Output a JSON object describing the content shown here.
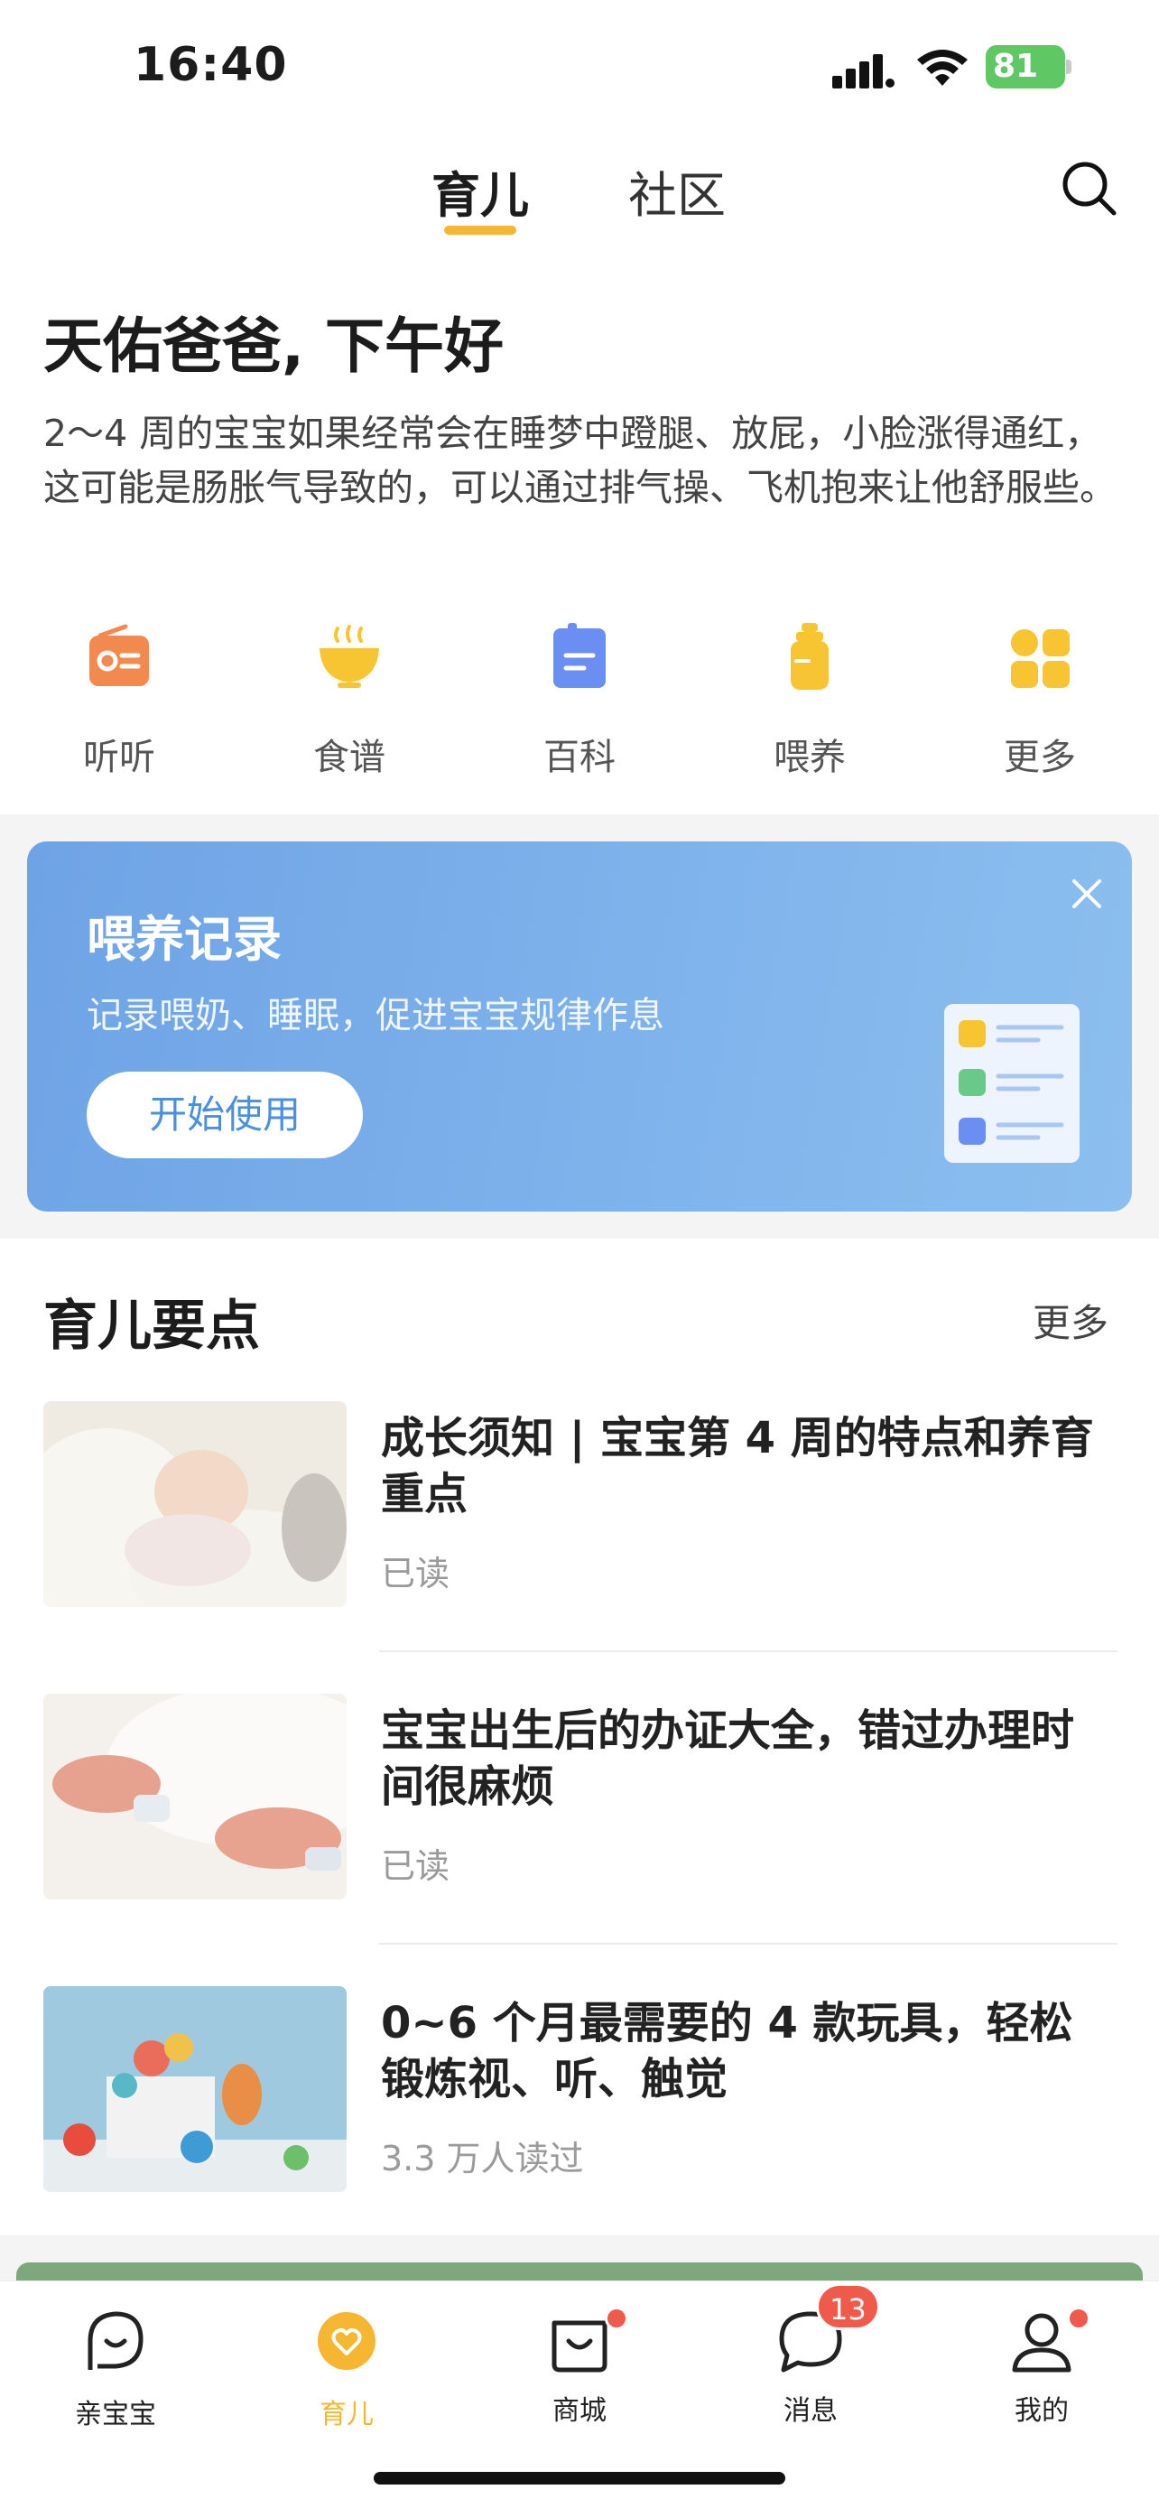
{
  "status_bar": {
    "time": "16:40",
    "battery": "81"
  },
  "top_tabs": [
    {
      "label": "育儿",
      "active": true
    },
    {
      "label": "社区",
      "active": false
    }
  ],
  "greeting": "天佑爸爸, 下午好",
  "tip": "2～4 周的宝宝如果经常会在睡梦中蹬腿、放屁，小脸涨得通红，这可能是肠胀气导致的，可以通过排气操、飞机抱来让他舒服些。",
  "quick_entries": [
    {
      "label": "听听",
      "icon": "radio-icon",
      "color": "#f2894e"
    },
    {
      "label": "食谱",
      "icon": "bowl-icon",
      "color": "#f7c531"
    },
    {
      "label": "百科",
      "icon": "book-icon",
      "color": "#6b8ef2"
    },
    {
      "label": "喂养",
      "icon": "bottle-icon",
      "color": "#f7c531"
    },
    {
      "label": "更多",
      "icon": "grid-icon",
      "color": "#f7c531"
    }
  ],
  "banner": {
    "title": "喂养记录",
    "subtitle": "记录喂奶、睡眠，促进宝宝规律作息",
    "button": "开始使用"
  },
  "section": {
    "title": "育儿要点",
    "more": "更多"
  },
  "articles": [
    {
      "title": "成长须知 | 宝宝第 4 周的特点和养育重点",
      "meta": "已读"
    },
    {
      "title": "宝宝出生后的办证大全，错过办理时间很麻烦",
      "meta": "已读"
    },
    {
      "title": "0~6 个月最需要的 4 款玩具，轻松锻炼视、听、触觉",
      "meta": "3.3 万人读过"
    }
  ],
  "bottom_nav": [
    {
      "label": "亲宝宝",
      "active": false
    },
    {
      "label": "育儿",
      "active": true
    },
    {
      "label": "商城",
      "active": false,
      "dot": true
    },
    {
      "label": "消息",
      "active": false,
      "badge": "13"
    },
    {
      "label": "我的",
      "active": false,
      "dot": true
    }
  ],
  "colors": {
    "accent": "#f5b731",
    "badge": "#ef5a4b",
    "banner": "#6ea3e6"
  }
}
